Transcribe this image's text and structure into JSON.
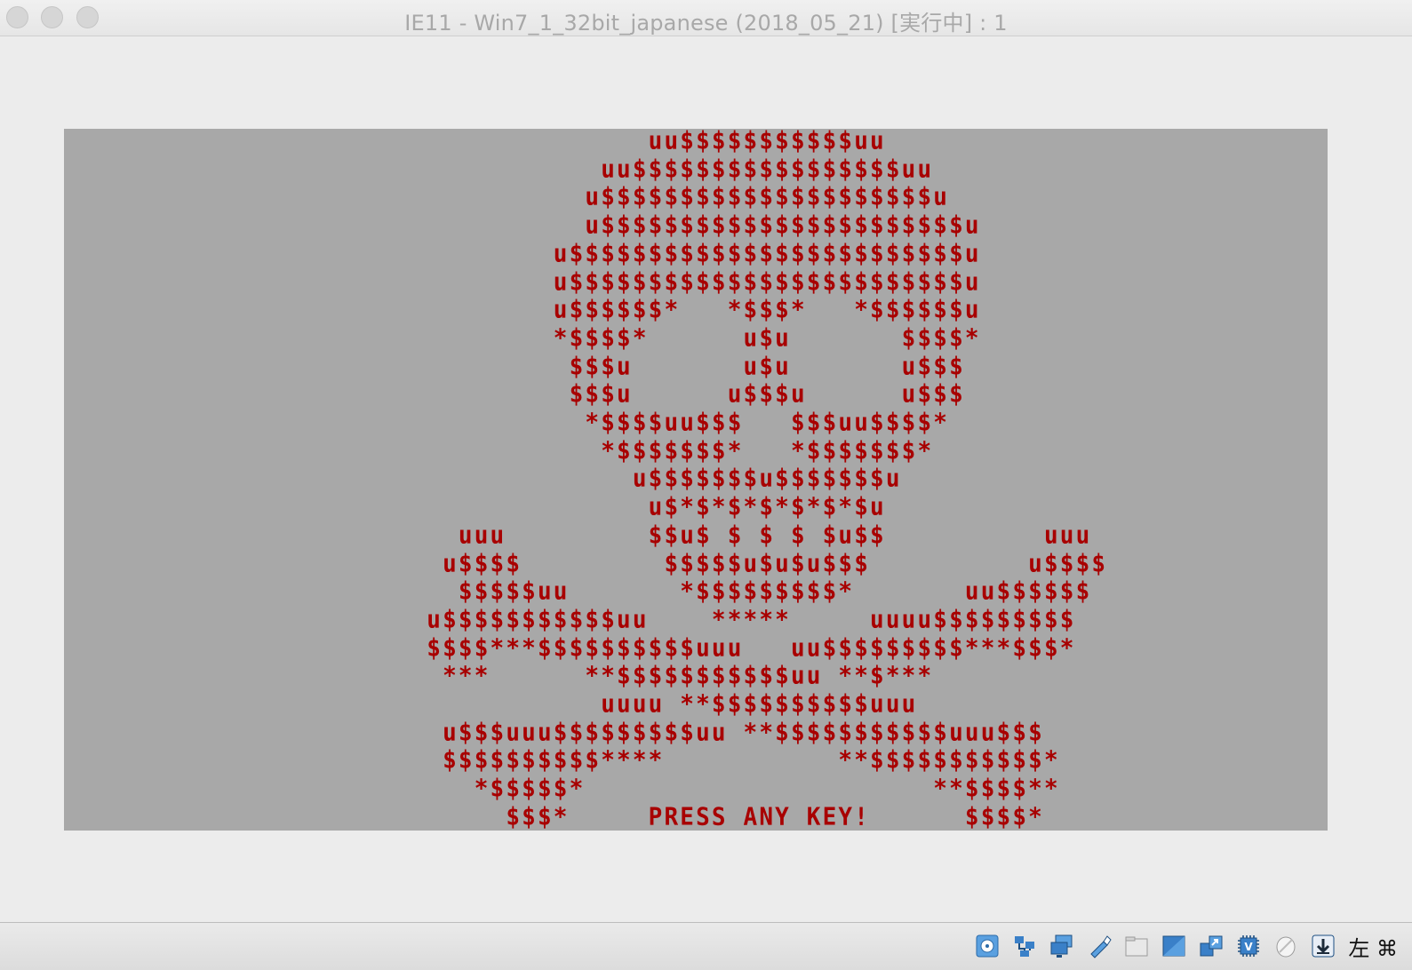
{
  "window": {
    "title": "IE11 - Win7_1_32bit_japanese (2018_05_21) [実行中] : 1"
  },
  "screen": {
    "text_color": "#a80000",
    "background_color": "#a8a8a8",
    "lines": [
      "                  uu$$$$$$$$$$$uu",
      "               uu$$$$$$$$$$$$$$$$$uu",
      "              u$$$$$$$$$$$$$$$$$$$$$u",
      "              u$$$$$$$$$$$$$$$$$$$$$$$u",
      "            u$$$$$$$$$$$$$$$$$$$$$$$$$u",
      "            u$$$$$$$$$$$$$$$$$$$$$$$$$u",
      "            u$$$$$$*   *$$$*   *$$$$$$u",
      "            *$$$$*      u$u       $$$$*",
      "             $$$u       u$u       u$$$",
      "             $$$u      u$$$u      u$$$",
      "              *$$$$uu$$$   $$$uu$$$$*",
      "               *$$$$$$$*   *$$$$$$$*",
      "                 u$$$$$$$u$$$$$$$u",
      "                  u$*$*$*$*$*$*$u",
      "      uuu         $$u$ $ $ $ $u$$          uuu",
      "     u$$$$         $$$$$u$u$u$$$          u$$$$",
      "      $$$$$uu       *$$$$$$$$$*       uu$$$$$$",
      "    u$$$$$$$$$$$uu    *****     uuuu$$$$$$$$$",
      "    $$$$***$$$$$$$$$$uuu   uu$$$$$$$$$***$$$*",
      "     ***      **$$$$$$$$$$$uu **$***",
      "               uuuu **$$$$$$$$$$uuu",
      "     u$$$uuu$$$$$$$$$uu **$$$$$$$$$$$uuu$$$",
      "     $$$$$$$$$$****           **$$$$$$$$$$$*",
      "       *$$$$$*                      **$$$$**",
      "         $$$*     PRESS ANY KEY!      $$$$*"
    ]
  },
  "statusbar": {
    "icons": [
      "optical-drive-icon",
      "network-icon",
      "display-icon",
      "usb-icon",
      "shared-folder-icon",
      "screen-icon",
      "capture-icon",
      "cpu-icon",
      "mouse-icon",
      "download-icon"
    ],
    "host_key": "左 ⌘"
  }
}
